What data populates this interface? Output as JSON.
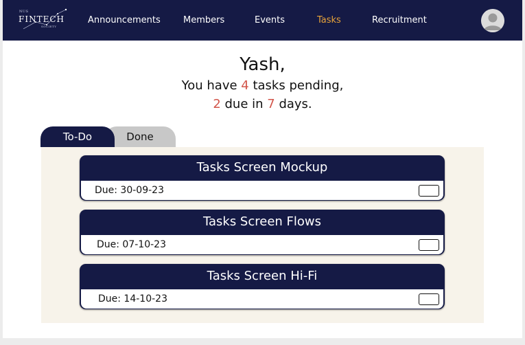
{
  "brand": {
    "logo_top": "NUS",
    "logo_main": "FINTECH",
    "logo_sub": "SOCIETY"
  },
  "nav": {
    "items": [
      {
        "label": "Announcements"
      },
      {
        "label": "Members"
      },
      {
        "label": "Events"
      },
      {
        "label": "Tasks",
        "active": true
      },
      {
        "label": "Recruitment"
      }
    ],
    "avatar_icon": "user-avatar-icon",
    "active_color": "#e8a33a",
    "background_color": "#151a45"
  },
  "greeting": {
    "name": "Yash,",
    "line1_prefix": "You have ",
    "line1_count": "4",
    "line1_suffix": " tasks pending,",
    "line2_count": "2",
    "line2_middle": " due in ",
    "line2_days": "7",
    "line2_suffix": " days.",
    "highlight_color": "#d2554a"
  },
  "tabs": {
    "todo": "To-Do",
    "done": "Done",
    "active": "To-Do"
  },
  "tasks": [
    {
      "title": "Tasks Screen Mockup",
      "due": "Due: 30-09-23",
      "done": false
    },
    {
      "title": "Tasks Screen Flows",
      "due": "Due: 07-10-23",
      "done": false
    },
    {
      "title": "Tasks Screen Hi-Fi",
      "due": "Due: 14-10-23",
      "done": false
    }
  ]
}
